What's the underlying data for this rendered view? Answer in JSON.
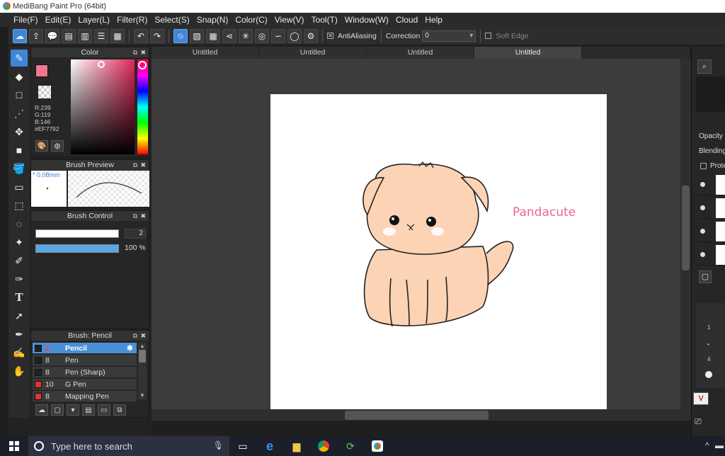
{
  "window": {
    "title": "MediBang Paint Pro (64bit)"
  },
  "menu": [
    "File(F)",
    "Edit(E)",
    "Layer(L)",
    "Filter(R)",
    "Select(S)",
    "Snap(N)",
    "Color(C)",
    "View(V)",
    "Tool(T)",
    "Window(W)",
    "Cloud",
    "Help"
  ],
  "toolbar": {
    "antialiasing_label": "AntiAliasing",
    "correction_label": "Correction",
    "correction_value": "0",
    "soft_edge_label": "Soft Edge"
  },
  "color_panel": {
    "title": "Color",
    "r": "R:239",
    "g": "G:119",
    "b": "B:146",
    "hex": "#EF7792",
    "main_color": "#EF7792"
  },
  "brush_preview": {
    "title": "Brush Preview",
    "size_label": "* 0.08mm"
  },
  "brush_control": {
    "title": "Brush Control",
    "size_value": "2",
    "size_fraction": 1.0,
    "opacity_value": "100 %",
    "opacity_fraction": 1.0
  },
  "brush_panel": {
    "title": "Brush: Pencil",
    "items": [
      {
        "size": "2",
        "name": "Pencil",
        "color": "#222222",
        "selected": true
      },
      {
        "size": "8",
        "name": "Pen",
        "color": "#222222"
      },
      {
        "size": "8",
        "name": "Pen (Sharp)",
        "color": "#222222"
      },
      {
        "size": "10",
        "name": "G Pen",
        "color": "#e53333"
      },
      {
        "size": "8",
        "name": "Mapping Pen",
        "color": "#e53333"
      }
    ]
  },
  "tabs": [
    "Untitled",
    "Untitled",
    "Untitled",
    "Untitled"
  ],
  "canvas": {
    "signature": "Pandacute"
  },
  "layer_panel": {
    "opacity_label": "Opacity",
    "blending_label": "Blending",
    "protect_label": "Prote",
    "scale_labels": [
      "1",
      "•",
      "4"
    ]
  },
  "taskbar": {
    "search_placeholder": "Type here to search"
  }
}
